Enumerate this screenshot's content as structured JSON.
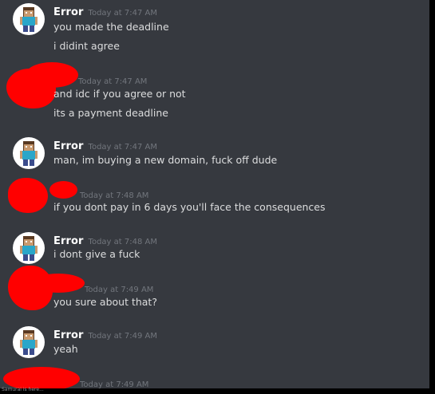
{
  "colors": {
    "background": "#36393f",
    "author": "#ffffff",
    "timestamp": "#72767d",
    "text": "#dcddde",
    "redaction": "#ff0000"
  },
  "messages": [
    {
      "author": "Error",
      "timestamp": "Today at 7:47 AM",
      "lines": [
        "you made the deadline",
        "i didint agree"
      ]
    },
    {
      "author": "",
      "timestamp": "Today at 7:47 AM",
      "lines": [
        "and idc if you agree or not",
        "its a payment deadline"
      ]
    },
    {
      "author": "Error",
      "timestamp": "Today at 7:47 AM",
      "lines": [
        "man, im buying a new domain, fuck off dude"
      ]
    },
    {
      "author": "",
      "timestamp": "Today at 7:48 AM",
      "lines": [
        "if you dont pay in 6 days you'll face the consequences"
      ]
    },
    {
      "author": "Error",
      "timestamp": "Today at 7:48 AM",
      "lines": [
        "i dont give a fuck"
      ]
    },
    {
      "author": "",
      "timestamp": "Today at 7:49 AM",
      "lines": [
        "you sure about that?"
      ]
    },
    {
      "author": "Error",
      "timestamp": "Today at 7:49 AM",
      "lines": [
        "yeah"
      ]
    },
    {
      "author": "",
      "timestamp": "Today at 7:49 AM",
      "lines": []
    }
  ],
  "footer": {
    "text": "Samurai is here..."
  }
}
